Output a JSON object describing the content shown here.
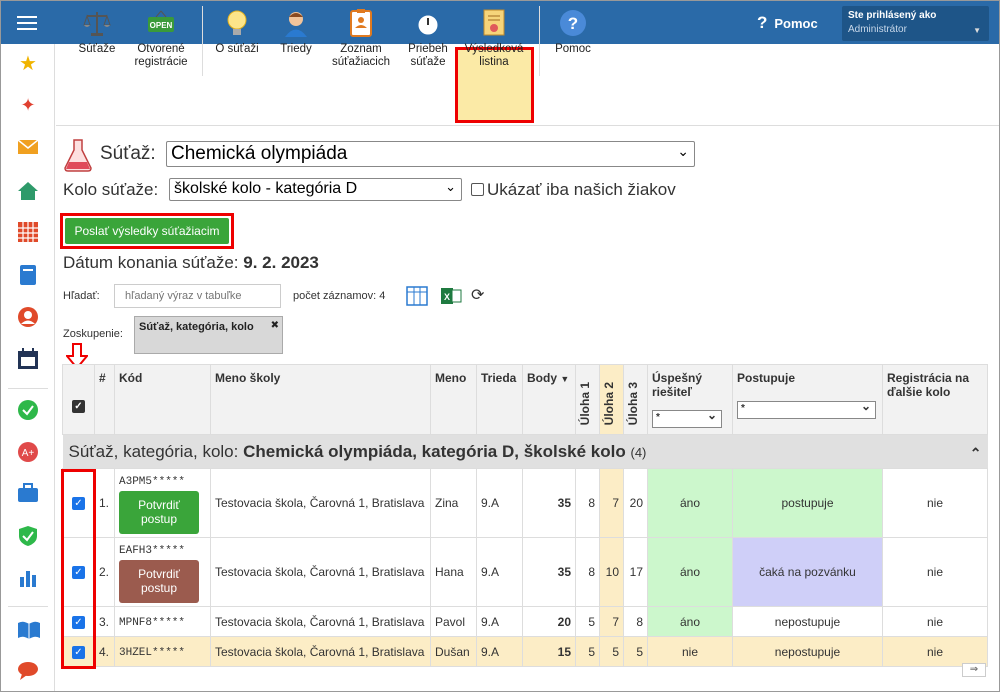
{
  "topbar": {
    "help_label": "Pomoc",
    "user_line1": "Ste prihlásený ako",
    "user_line2": "Administrátor"
  },
  "toolbar": {
    "items": [
      {
        "label1": "Súťaže",
        "label2": ""
      },
      {
        "label1": "Otvorené",
        "label2": "registrácie"
      },
      {
        "label1": "O súťaži",
        "label2": ""
      },
      {
        "label1": "Triedy",
        "label2": ""
      },
      {
        "label1": "Zoznam",
        "label2": "súťažiacich"
      },
      {
        "label1": "Priebeh",
        "label2": "súťaže"
      },
      {
        "label1": "Výsledková",
        "label2": "listina"
      },
      {
        "label1": "Pomoc",
        "label2": ""
      }
    ],
    "open_badge": "OPEN"
  },
  "form": {
    "contest_label": "Súťaž:",
    "contest_value": "Chemická olympiáda",
    "round_label": "Kolo súťaže:",
    "round_value": "školské kolo - kategória D",
    "only_ours_label": "Ukázať iba našich žiakov",
    "send_button": "Poslať výsledky súťažiacim",
    "date_label": "Dátum konania súťaže:",
    "date_value": "9. 2. 2023",
    "search_label": "Hľadať:",
    "search_placeholder": "hľadaný výraz v tabuľke",
    "count_label": "počet záznamov: 4",
    "grouping_label": "Zoskupenie:",
    "grouping_value": "Súťaž, kategória, kolo",
    "grouping_close": "✖"
  },
  "table": {
    "headers": {
      "num": "#",
      "code": "Kód",
      "school": "Meno školy",
      "name": "Meno",
      "class": "Trieda",
      "points": "Body",
      "sort": "▼",
      "u1": "Úloha 1",
      "u2": "Úloha 2",
      "u3": "Úloha 3",
      "success": "Úspešný riešiteľ",
      "advances": "Postupuje",
      "registration": "Registrácia na ďalšie kolo",
      "filter_any": "*"
    },
    "group": {
      "prefix": "Súťaž, kategória, kolo:",
      "title": "Chemická olympiáda, kategória D, školské kolo",
      "count": "(4)",
      "collapse": "⌃"
    },
    "rows": [
      {
        "num": "1.",
        "code": "A3PM5*****",
        "button": "Potvrdiť postup",
        "school": "Testovacia škola, Čarovná 1, Bratislava",
        "name": "Zina",
        "class": "9.A",
        "points": "35",
        "u1": "8",
        "u2": "7",
        "u3": "20",
        "success": "áno",
        "advances": "postupuje",
        "registration": "nie"
      },
      {
        "num": "2.",
        "code": "EAFH3*****",
        "button": "Potvrdiť postup",
        "school": "Testovacia škola, Čarovná 1, Bratislava",
        "name": "Hana",
        "class": "9.A",
        "points": "35",
        "u1": "8",
        "u2": "10",
        "u3": "17",
        "success": "áno",
        "advances": "čaká na pozvánku",
        "registration": "nie"
      },
      {
        "num": "3.",
        "code": "MPNF8*****",
        "school": "Testovacia škola, Čarovná 1, Bratislava",
        "name": "Pavol",
        "class": "9.A",
        "points": "20",
        "u1": "5",
        "u2": "7",
        "u3": "8",
        "success": "áno",
        "advances": "nepostupuje",
        "registration": "nie"
      },
      {
        "num": "4.",
        "code": "3HZEL*****",
        "school": "Testovacia škola, Čarovná 1, Bratislava",
        "name": "Dušan",
        "class": "9.A",
        "points": "15",
        "u1": "5",
        "u2": "5",
        "u3": "5",
        "success": "nie",
        "advances": "nepostupuje",
        "registration": "nie"
      }
    ]
  },
  "colors": {
    "topbar": "#2a6aa8",
    "highlight": "#e00000",
    "success_green": "#ccf7cc",
    "waiting_purple": "#cfcff8",
    "row_yellow": "#fcedc6",
    "confirm_green": "#3aa53a",
    "confirm_brown": "#9b5b4e"
  }
}
